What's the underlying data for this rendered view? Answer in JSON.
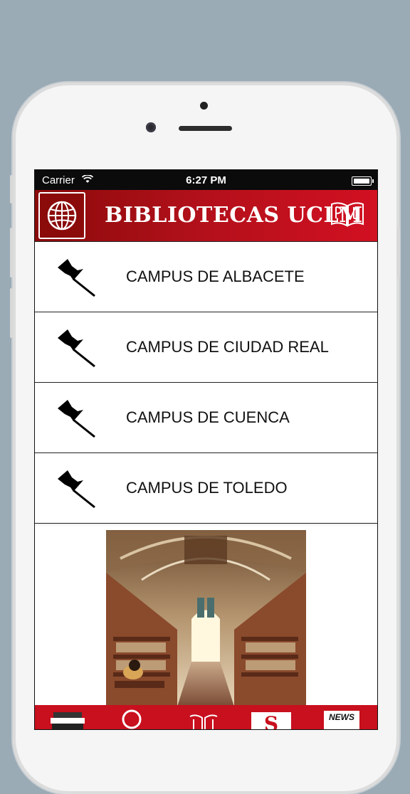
{
  "status_bar": {
    "carrier": "Carrier",
    "time": "6:27 PM"
  },
  "header": {
    "title": "BIBLIOTECAS UCLM",
    "globe_icon": "globe-icon",
    "logo_icon": "book-logo-icon"
  },
  "campuses": [
    {
      "label": "CAMPUS DE ALBACETE",
      "icon": "pushpin-icon"
    },
    {
      "label": "CAMPUS DE CIUDAD REAL",
      "icon": "pushpin-icon"
    },
    {
      "label": "CAMPUS DE CUENCA",
      "icon": "pushpin-icon"
    },
    {
      "label": "CAMPUS DE TOLEDO",
      "icon": "pushpin-icon"
    }
  ],
  "tabbar": {
    "items": [
      {
        "icon": "books-icon"
      },
      {
        "icon": "search-icon"
      },
      {
        "icon": "library-logo-icon"
      },
      {
        "icon": "s-logo-icon",
        "label": "S"
      },
      {
        "icon": "news-icon",
        "label": "NEWS"
      }
    ]
  },
  "colors": {
    "accent": "#c8101e",
    "header_dark": "#8a0a0a",
    "background": "#9aabb6"
  }
}
